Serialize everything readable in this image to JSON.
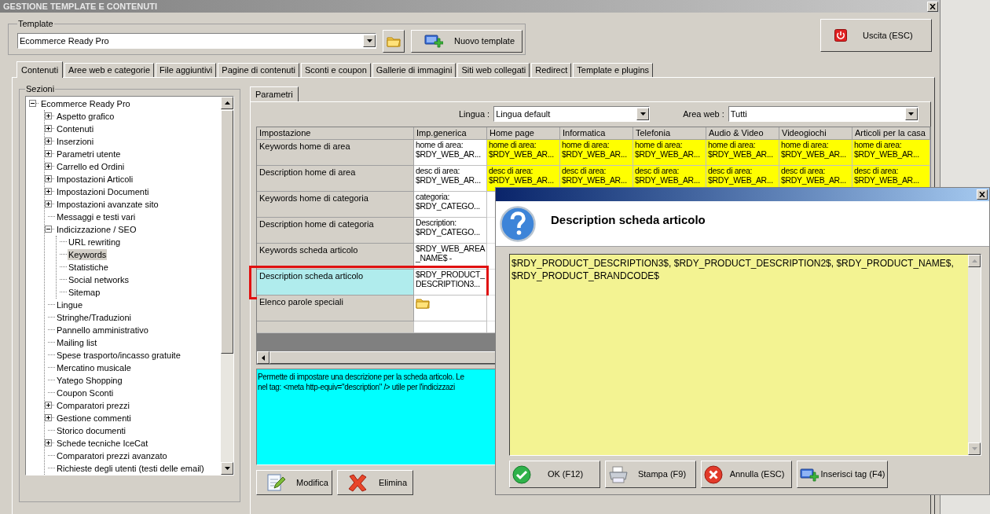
{
  "window": {
    "title": "GESTIONE TEMPLATE E CONTENUTI"
  },
  "template": {
    "label": "Template",
    "value": "Ecommerce Ready Pro",
    "new_button": "Nuovo template"
  },
  "exit_button": "Uscita (ESC)",
  "tabs": [
    {
      "label": "Contenuti",
      "selected": true
    },
    {
      "label": "Aree web e categorie",
      "selected": false
    },
    {
      "label": "File aggiuntivi",
      "selected": false
    },
    {
      "label": "Pagine di contenuti",
      "selected": false
    },
    {
      "label": "Sconti e coupon",
      "selected": false
    },
    {
      "label": "Gallerie di immagini",
      "selected": false
    },
    {
      "label": "Siti web collegati",
      "selected": false
    },
    {
      "label": "Redirect",
      "selected": false
    },
    {
      "label": "Template e plugins",
      "selected": false
    }
  ],
  "sections": {
    "label": "Sezioni",
    "tree": [
      {
        "label": "Ecommerce Ready Pro",
        "expanded": true,
        "selected": false,
        "children": [
          {
            "label": "Aspetto grafico",
            "expanded": false,
            "selected": false
          },
          {
            "label": "Contenuti",
            "expanded": false,
            "selected": false
          },
          {
            "label": "Inserzioni",
            "expanded": false,
            "selected": false
          },
          {
            "label": "Parametri utente",
            "expanded": false,
            "selected": false
          },
          {
            "label": "Carrello ed Ordini",
            "expanded": false,
            "selected": false
          },
          {
            "label": "Impostazioni Articoli",
            "expanded": false,
            "selected": false
          },
          {
            "label": "Impostazioni Documenti",
            "expanded": false,
            "selected": false
          },
          {
            "label": "Impostazioni avanzate sito",
            "expanded": false,
            "selected": false
          },
          {
            "label": "Messaggi e testi vari",
            "selected": false
          },
          {
            "label": "Indicizzazione / SEO",
            "expanded": true,
            "selected": false,
            "children": [
              {
                "label": "URL rewriting",
                "selected": false
              },
              {
                "label": "Keywords",
                "selected": true
              },
              {
                "label": "Statistiche",
                "selected": false
              },
              {
                "label": "Social networks",
                "selected": false
              },
              {
                "label": "Sitemap",
                "selected": false
              }
            ]
          },
          {
            "label": "Lingue",
            "selected": false
          },
          {
            "label": "Stringhe/Traduzioni",
            "selected": false
          },
          {
            "label": "Pannello amministrativo",
            "selected": false
          },
          {
            "label": "Mailing list",
            "selected": false
          },
          {
            "label": "Spese trasporto/incasso gratuite",
            "selected": false
          },
          {
            "label": "Mercatino musicale",
            "selected": false
          },
          {
            "label": "Yatego Shopping",
            "selected": false
          },
          {
            "label": "Coupon Sconti",
            "selected": false
          },
          {
            "label": "Comparatori prezzi",
            "expanded": false,
            "selected": false
          },
          {
            "label": "Gestione commenti",
            "expanded": false,
            "selected": false
          },
          {
            "label": "Storico documenti",
            "selected": false
          },
          {
            "label": "Schede tecniche IceCat",
            "expanded": false,
            "selected": false
          },
          {
            "label": "Comparatori prezzi avanzato",
            "selected": false
          },
          {
            "label": "Richieste degli utenti (testi delle email)",
            "selected": false
          }
        ]
      }
    ]
  },
  "params_tab": {
    "label": "Parametri",
    "selected": true
  },
  "filters": [
    {
      "label": "Lingua :",
      "value": "Lingua default"
    },
    {
      "label": "Area web :",
      "value": "Tutti"
    }
  ],
  "grid": {
    "columns": [
      "Impostazione",
      "Imp.generica",
      "Home page",
      "Informatica",
      "Telefonia",
      "Audio & Video",
      "Videogiochi",
      "Articoli per la casa"
    ],
    "rows": [
      {
        "kind": "text",
        "setting": "Keywords home di area",
        "generic": "home di area:\n$RDY_WEB_AR...",
        "values": [
          "home di area:\n$RDY_WEB_AR...",
          "home di area:\n$RDY_WEB_AR...",
          "home di area:\n$RDY_WEB_AR...",
          "home di area:\n$RDY_WEB_AR...",
          "home di area:\n$RDY_WEB_AR...",
          "home di area:\n$RDY_WEB_AR..."
        ],
        "selected": false,
        "highlighted": false
      },
      {
        "kind": "text",
        "setting": "Description home di area",
        "generic": "desc di area:\n$RDY_WEB_AR...",
        "values": [
          "desc di area:\n$RDY_WEB_AR...",
          "desc di area:\n$RDY_WEB_AR...",
          "desc di area:\n$RDY_WEB_AR...",
          "desc di area:\n$RDY_WEB_AR...",
          "desc di area:\n$RDY_WEB_AR...",
          "desc di area:\n$RDY_WEB_AR..."
        ],
        "selected": false,
        "highlighted": false
      },
      {
        "kind": "text",
        "setting": "Keywords home di categoria",
        "generic": "categoria:\n$RDY_CATEGO...",
        "selected": false,
        "highlighted": false
      },
      {
        "kind": "text",
        "setting": "Description home di categoria",
        "generic": "Description:\n$RDY_CATEGO...",
        "selected": false,
        "highlighted": false
      },
      {
        "kind": "text",
        "setting": "Keywords scheda articolo",
        "generic": "$RDY_WEB_AREA\n_NAME$ -",
        "selected": false,
        "highlighted": false
      },
      {
        "kind": "text",
        "setting": "Description scheda articolo",
        "generic": "$RDY_PRODUCT_\nDESCRIPTION3...",
        "selected": true,
        "highlighted": true
      },
      {
        "kind": "folder",
        "setting": "Elenco parole speciali",
        "selected": false,
        "highlighted": false
      }
    ]
  },
  "help_text": [
    "Permette di impostare una descrizione per la scheda articolo. Le",
    "nel tag: <meta http-equiv=\"description\" /> utile per l'indicizzazi"
  ],
  "actions": [
    {
      "label": "Modifica",
      "kind": "edit"
    },
    {
      "label": "Elimina",
      "kind": "delete"
    }
  ],
  "dialog": {
    "title": "Description scheda articolo",
    "value": "$RDY_PRODUCT_DESCRIPTION3$, $RDY_PRODUCT_DESCRIPTION2$, $RDY_PRODUCT_NAME$, $RDY_PRODUCT_BRANDCODE$",
    "buttons": [
      {
        "label": "OK (F12)",
        "kind": "ok"
      },
      {
        "label": "Stampa (F9)",
        "kind": "print"
      },
      {
        "label": "Annulla (ESC)",
        "kind": "cancel"
      },
      {
        "label": "Inserisci tag (F4)",
        "kind": "tag"
      }
    ]
  }
}
